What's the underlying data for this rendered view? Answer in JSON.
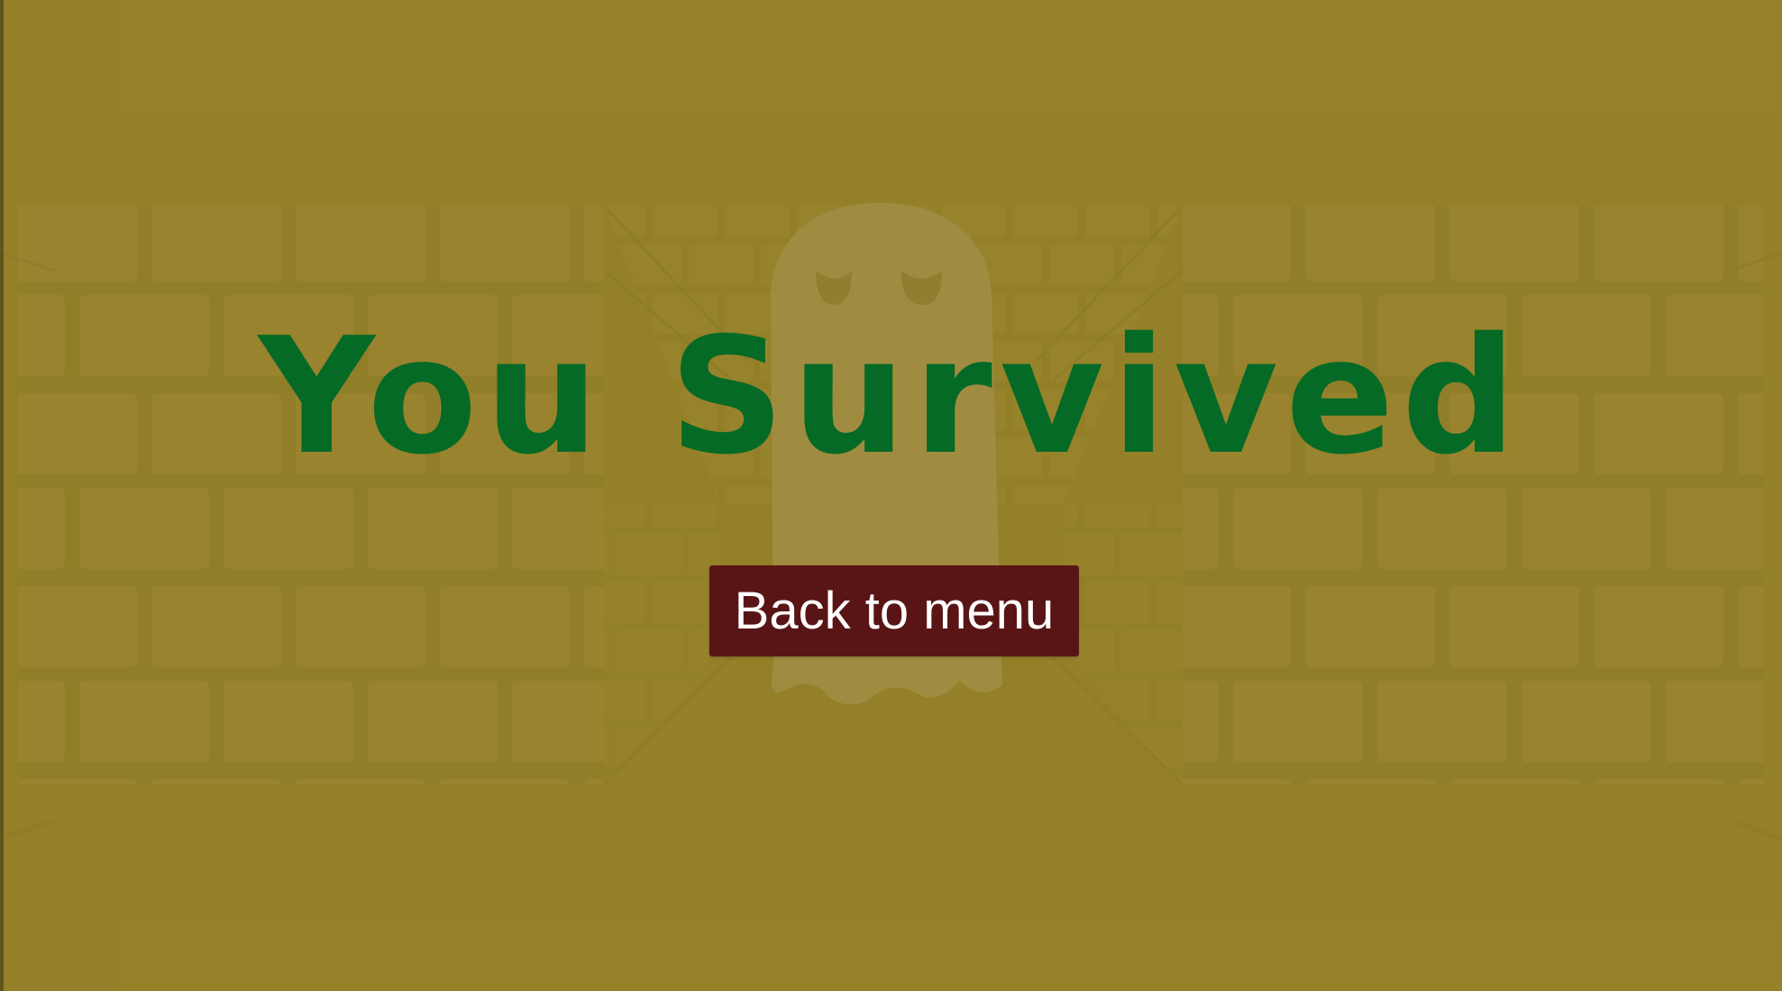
{
  "game_over": {
    "title": "You Survived",
    "back_button_label": "Back to menu"
  },
  "colors": {
    "background": "#948128",
    "brick": "#a28a35",
    "mortar": "#8c7a27",
    "ghost": "#b19e5c",
    "title": "#056a26",
    "button_bg": "#591515",
    "button_text": "#ffffff"
  },
  "background_art": {
    "icons": [
      "brick-wall",
      "ghost-icon",
      "spider-web"
    ]
  }
}
